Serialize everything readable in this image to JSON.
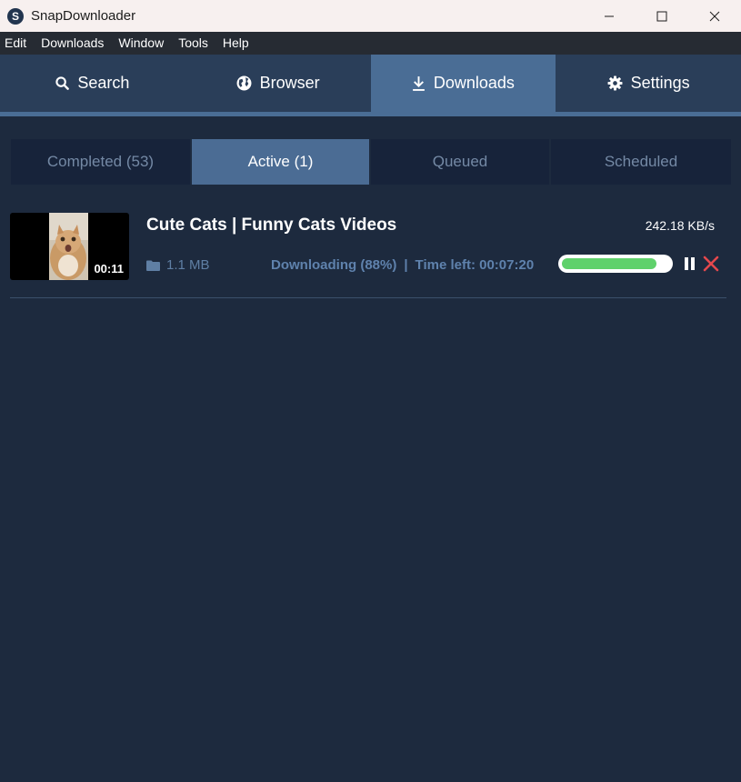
{
  "window": {
    "title": "SnapDownloader",
    "logo_letter": "S"
  },
  "menu": {
    "items": [
      "Edit",
      "Downloads",
      "Window",
      "Tools",
      "Help"
    ]
  },
  "nav": {
    "tabs": [
      {
        "label": "Search",
        "icon": "search-icon"
      },
      {
        "label": "Browser",
        "icon": "globe-icon"
      },
      {
        "label": "Downloads",
        "icon": "download-icon",
        "active": true
      },
      {
        "label": "Settings",
        "icon": "gear-icon"
      }
    ]
  },
  "subtabs": [
    {
      "label": "Completed (53)"
    },
    {
      "label": "Active (1)",
      "active": true
    },
    {
      "label": "Queued"
    },
    {
      "label": "Scheduled"
    }
  ],
  "download": {
    "title": "Cute Cats | Funny Cats Videos",
    "speed": "242.18 KB/s",
    "duration": "00:11",
    "size": "1.1 MB",
    "status": "Downloading (88%)",
    "separator": "|",
    "time_left": "Time left: 00:07:20",
    "progress": 0.88
  },
  "colors": {
    "background": "#1d2a3e",
    "accent": "#4a6d95",
    "progress_fill": "#5fd16b",
    "cancel": "#e5484d"
  }
}
